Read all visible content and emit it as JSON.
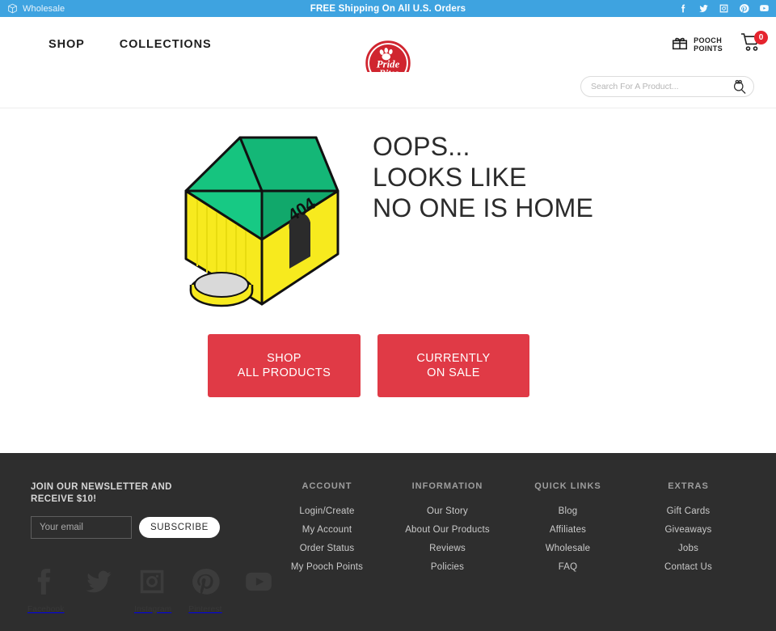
{
  "topbar": {
    "wholesale_label": "Wholesale",
    "wholesale_icon": "box-icon",
    "shipping_message": "FREE Shipping On All U.S. Orders",
    "social": [
      {
        "name": "facebook-icon",
        "label": "Facebook"
      },
      {
        "name": "twitter-icon",
        "label": "Twitter"
      },
      {
        "name": "instagram-icon",
        "label": "Instagram"
      },
      {
        "name": "pinterest-icon",
        "label": "Pinterest"
      },
      {
        "name": "youtube-icon",
        "label": "YouTube"
      }
    ],
    "bg_color": "#3ea3e0"
  },
  "header": {
    "nav": [
      {
        "label": "SHOP"
      },
      {
        "label": "COLLECTIONS"
      }
    ],
    "logo_alt": "PrideBites",
    "logo_text_top": "Pride",
    "logo_text_bottom": "Bites",
    "pooch_points_line1": "POOCH",
    "pooch_points_line2": "POINTS",
    "pooch_points_icon": "gift-icon",
    "cart_icon": "cart-icon",
    "cart_count": "0",
    "cart_badge_color": "#e5242e"
  },
  "search": {
    "placeholder": "Search For A Product...",
    "value": "",
    "icon": "search-magnifier-icon"
  },
  "main": {
    "illustration": "doghouse-404-illustration",
    "doghouse_number": "404",
    "headline": "OOPS...\nLOOKS LIKE\nNO ONE IS HOME",
    "buttons": [
      {
        "label": "SHOP\nALL PRODUCTS",
        "name": "shop-all-products-button"
      },
      {
        "label": "CURRENTLY\nON SALE",
        "name": "currently-on-sale-button"
      }
    ],
    "button_color": "#e03a46"
  },
  "footer": {
    "bg_color": "#2e2e2e",
    "newsletter": {
      "title": "JOIN OUR NEWSLETTER AND RECEIVE $10!",
      "email_placeholder": "Your email",
      "email_value": "",
      "subscribe_label": "SUBSCRIBE"
    },
    "social": [
      {
        "name": "facebook-icon",
        "label": "Facebook"
      },
      {
        "name": "twitter-icon",
        "label": ""
      },
      {
        "name": "instagram-icon",
        "label": "Instagram"
      },
      {
        "name": "pinterest-icon",
        "label": "Pinterest"
      },
      {
        "name": "youtube-icon",
        "label": ""
      }
    ],
    "columns": [
      {
        "title": "ACCOUNT",
        "links": [
          "Login/Create",
          "My Account",
          "Order Status",
          "My Pooch Points"
        ]
      },
      {
        "title": "INFORMATION",
        "links": [
          "Our Story",
          "About Our Products",
          "Reviews",
          "Policies"
        ]
      },
      {
        "title": "QUICK LINKS",
        "links": [
          "Blog",
          "Affiliates",
          "Wholesale",
          "FAQ"
        ]
      },
      {
        "title": "EXTRAS",
        "links": [
          "Gift Cards",
          "Giveaways",
          "Jobs",
          "Contact Us"
        ]
      }
    ]
  }
}
